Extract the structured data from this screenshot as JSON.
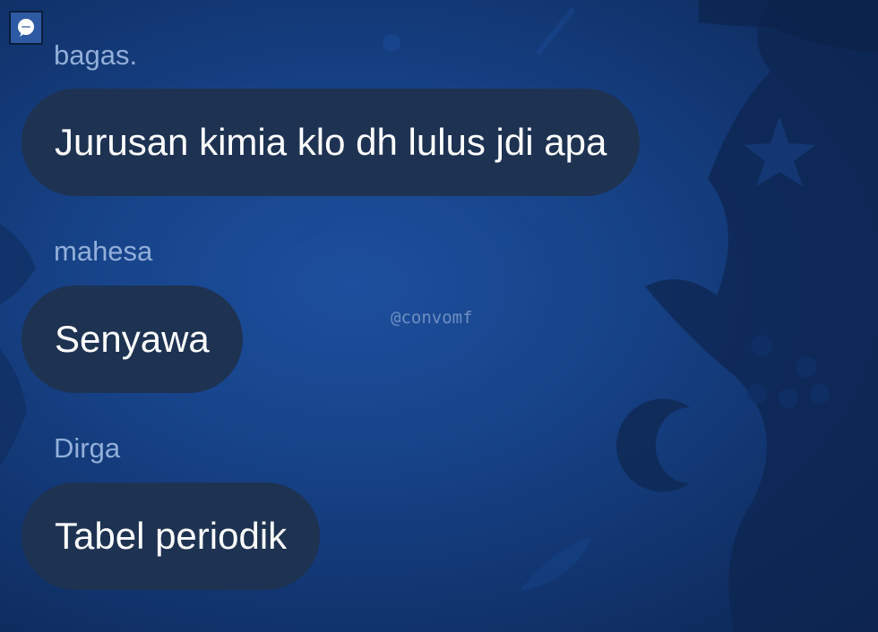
{
  "app": {
    "icon": "chat-bubble-icon"
  },
  "messages": [
    {
      "sender": "bagas.",
      "text": "Jurusan kimia klo dh lulus jdi apa"
    },
    {
      "sender": "mahesa",
      "text": "Senyawa"
    },
    {
      "sender": "Dirga",
      "text": "Tabel periodik"
    }
  ],
  "watermark": "@convomf",
  "colors": {
    "background": "#174389",
    "bubble": "#1e3252",
    "sender_text": "#93afd9",
    "message_text": "#ffffff"
  }
}
